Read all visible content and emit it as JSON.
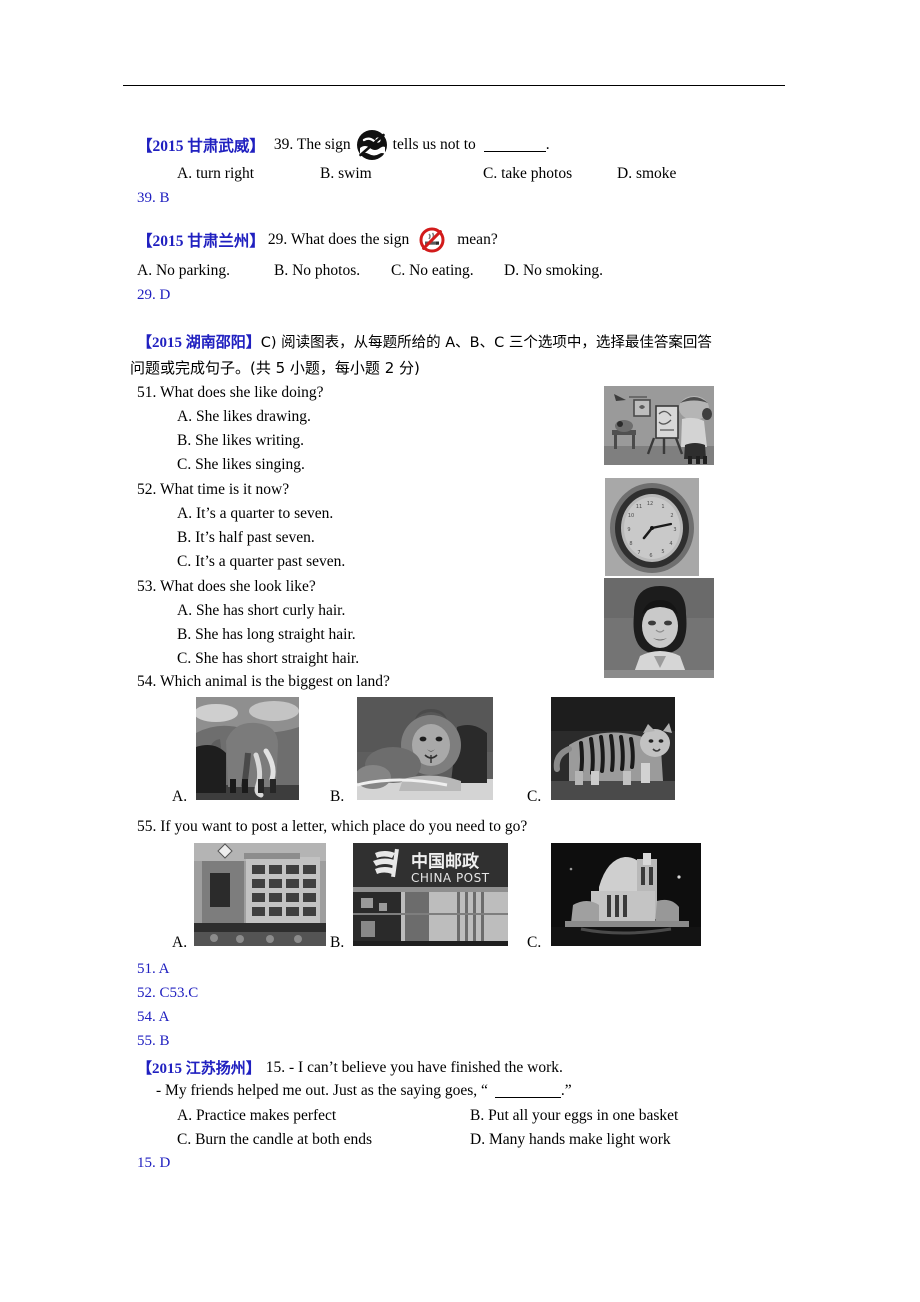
{
  "document": {
    "type": "exam-worksheet",
    "language": "en-zh",
    "accent_blue": "#2020c0",
    "text_color": "#000000",
    "background": "#ffffff"
  },
  "sections": [
    {
      "id": "gansu-wuwei",
      "header": "【2015 甘肃武威】",
      "question_number": "39.",
      "stem_before_icon": "39. The sign",
      "icon": "no-swimming-sign",
      "stem_after_icon": "tells us not to",
      "stem_tail": ".",
      "options": [
        {
          "label": "A. turn right"
        },
        {
          "label": "B. swim"
        },
        {
          "label": "C. take photos"
        },
        {
          "label": "D. smoke"
        }
      ],
      "answer": "39. B"
    },
    {
      "id": "gansu-lanzhou",
      "header": "【2015 甘肃兰州】",
      "stem_before_icon": "29. What does the sign",
      "icon": "no-smoking-sign",
      "stem_after_icon": "mean?",
      "options": [
        {
          "label": "A. No parking."
        },
        {
          "label": "B. No photos."
        },
        {
          "label": "C. No eating."
        },
        {
          "label": "D. No smoking."
        }
      ],
      "answer": "29. D"
    },
    {
      "id": "hunan-shaoyang",
      "header": "【2015 湖南邵阳】",
      "instruction_line1": "C) 阅读图表，从每题所给的 A、B、C 三个选项中，选择最佳答案回答",
      "instruction_line2": "问题或完成句子。(共 5 小题，每小题 2 分)",
      "questions": [
        {
          "number": "51.",
          "stem": "51. What does she like doing?",
          "options": [
            "A. She likes drawing.",
            "B. She likes writing.",
            "C. She likes singing."
          ],
          "image": "girl-drawing-at-easel-photo"
        },
        {
          "number": "52.",
          "stem": "52. What time is it now?",
          "options": [
            "A. It’s a quarter to seven.",
            "B. It’s half past seven.",
            "C. It’s a quarter past seven."
          ],
          "image": "wall-clock-photo"
        },
        {
          "number": "53.",
          "stem": "53. What does she look like?",
          "options": [
            "A. She has short curly hair.",
            "B. She has long straight hair.",
            "C. She has short straight hair."
          ],
          "image": "woman-portrait-photo"
        },
        {
          "number": "54.",
          "stem": "54. Which animal is the biggest on land?",
          "image_options": [
            {
              "letter": "A.",
              "image": "elephant-photo"
            },
            {
              "letter": "B.",
              "image": "lion-photo"
            },
            {
              "letter": "C.",
              "image": "tiger-photo"
            }
          ]
        },
        {
          "number": "55.",
          "stem": "55. If you want to post a letter, which place do you need to go?",
          "image_options": [
            {
              "letter": "A.",
              "image": "department-store-building-photo"
            },
            {
              "letter": "B.",
              "image": "china-post-office-photo",
              "sign_text_cn": "中国邮政",
              "sign_text_en": "CHINA POST"
            },
            {
              "letter": "C.",
              "image": "illuminated-building-at-night-photo"
            }
          ]
        }
      ],
      "answers": [
        "51. A",
        "52. C53.C",
        "54. A",
        "55. B"
      ]
    },
    {
      "id": "jiangsu-yangzhou",
      "header": "【2015 江苏扬州】",
      "stem_line1": "15. - I can’t believe you have finished the work.",
      "stem_line2_pre": "- My friends helped me out. Just as the saying goes, “",
      "stem_line2_post": ".”",
      "options": [
        {
          "label": "A. Practice makes perfect"
        },
        {
          "label": "B. Put all your eggs in one basket"
        },
        {
          "label": "C. Burn the candle at both ends"
        },
        {
          "label": "D. Many hands make light work"
        }
      ],
      "answer": "15. D"
    }
  ]
}
